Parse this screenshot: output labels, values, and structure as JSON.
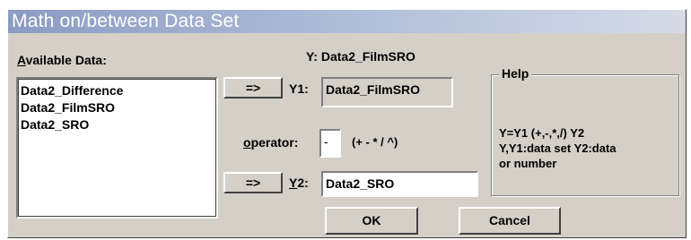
{
  "window": {
    "title": "Math on/between Data Set"
  },
  "available": {
    "label_hotkey": "A",
    "label_rest": "vailable Data:",
    "items": [
      "Data2_Difference",
      "Data2_FilmSRO",
      "Data2_SRO"
    ]
  },
  "y_header": "Y: Data2_FilmSRO",
  "y1": {
    "button": "=>",
    "label": "Y1:",
    "value": "Data2_FilmSRO"
  },
  "operator": {
    "label_hotkey": "o",
    "label_rest": "perator:",
    "value": "-",
    "hint": "(+ - * / ^)"
  },
  "y2": {
    "button": "=>",
    "label_hotkey": "Y",
    "label_rest": "2:",
    "value": "Data2_SRO"
  },
  "help": {
    "title": "Help",
    "lines": [
      "Y=Y1 (+,-,*,/) Y2",
      "Y,Y1:data set  Y2:data",
      "or number"
    ]
  },
  "buttons": {
    "ok": "OK",
    "cancel": "Cancel"
  }
}
